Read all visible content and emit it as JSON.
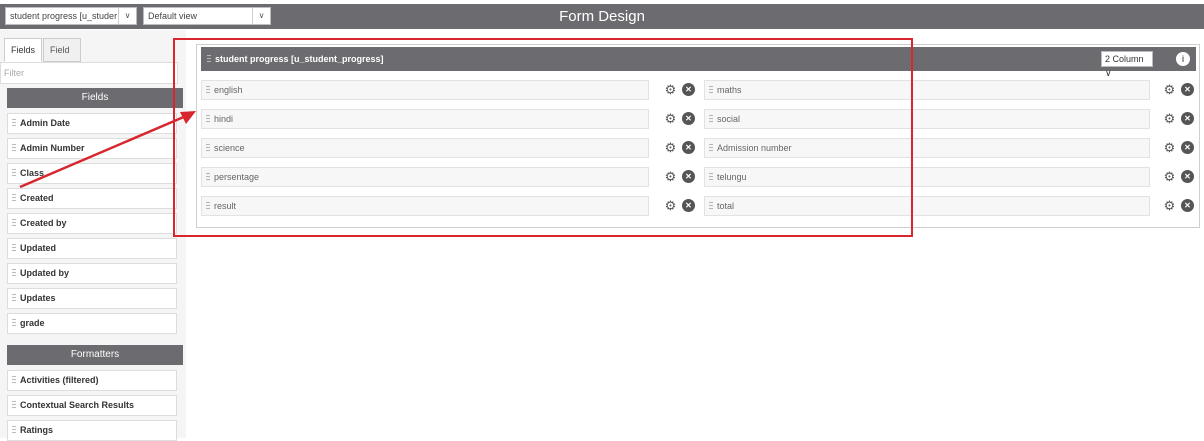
{
  "topbar": {
    "form_select": "student progress [u_studer",
    "view_select": "Default view",
    "title": "Form Design"
  },
  "sidebar": {
    "tabs": [
      {
        "label": "Fields",
        "active": true
      },
      {
        "label": "Field Types",
        "active": false
      }
    ],
    "filter_placeholder": "Filter",
    "fields_header": "Fields",
    "fields": [
      "Admin Date",
      "Admin Number",
      "Class",
      "Created",
      "Created by",
      "Updated",
      "Updated by",
      "Updates",
      "grade"
    ],
    "formatters_header": "Formatters",
    "formatters": [
      "Activities (filtered)",
      "Contextual Search Results",
      "Ratings"
    ]
  },
  "panel": {
    "title": "student progress [u_student_progress]",
    "columns_select": "2 Column",
    "info_icon": "i",
    "rows": [
      {
        "left": "english",
        "right": "maths"
      },
      {
        "left": "hindi",
        "right": "social"
      },
      {
        "left": "science",
        "right": "Admission number"
      },
      {
        "left": "persentage",
        "right": "telungu"
      },
      {
        "left": "result",
        "right": "total"
      }
    ]
  },
  "colors": {
    "header_bg": "#6b6b70",
    "annotation": "#d8262e"
  }
}
